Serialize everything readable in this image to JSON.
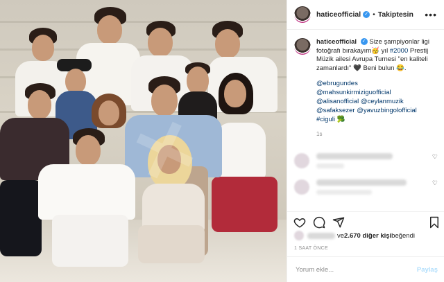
{
  "header": {
    "username": "haticeofficial",
    "separator": "•",
    "follow_status": "Takiptesin",
    "more_icon": "more-horizontal-icon"
  },
  "caption": {
    "username": "haticeofficial",
    "text_part1": "Size şampiyonlar ligi fotoğrafı bırakayım",
    "emoji1": "🥳",
    "text_part2": " yıl ",
    "hashtag_year": "#2000",
    "text_part3": " Prestij Müzik ailesi Avrupa Turnesi \"en kaliteli zamanlardı\" ",
    "emoji2": "🖤",
    "text_part4": " Beni bulun ",
    "emoji3": "😂",
    "text_part5": "."
  },
  "tags": [
    "@ebrugundes",
    "@mahsunkirmiziguofficial",
    "@alisanofficial @ceylanmuzik",
    "@safaksezer @yavuzbingolofficial",
    "#ciguli 🥦"
  ],
  "caption_time": "1s",
  "actions": {
    "like_icon": "heart-icon",
    "comment_icon": "comment-icon",
    "share_icon": "share-icon",
    "save_icon": "bookmark-icon"
  },
  "likes": {
    "text_middle": "ve ",
    "count": "2.670 diğer kişi",
    "text_end": " beğendi"
  },
  "time_ago": "1 SAAT ÖNCE",
  "comment_box": {
    "placeholder": "Yorum ekle...",
    "post_label": "Paylaş"
  },
  "colors": {
    "link": "#00376b",
    "verified": "#3897f0",
    "muted": "#8e8e8e",
    "post_disabled": "#b2dffc"
  }
}
